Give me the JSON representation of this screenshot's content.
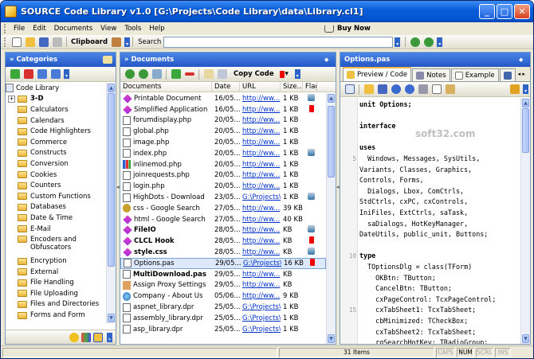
{
  "window": {
    "title": "SOURCE Code Library v1.0 [G:\\Projects\\Code Library\\data\\Library.cl1]"
  },
  "menu": {
    "items": [
      "File",
      "Edit",
      "Documents",
      "View",
      "Tools",
      "Help"
    ],
    "buy_now": "Buy Now"
  },
  "toolbar": {
    "clipboard_label": "Clipboard",
    "search_label": "Search",
    "search_value": ""
  },
  "categories": {
    "title": "» Categories",
    "root": "Code Library",
    "items": [
      "3-D",
      "Calculators",
      "Calendars",
      "Code Highlighters",
      "Commerce",
      "Constructs",
      "Conversion",
      "Cookies",
      "Counters",
      "Custom Functions",
      "Databases",
      "Date & Time",
      "E-Mail",
      "Encoders and Obfuscators",
      "Encryption",
      "External",
      "File Handling",
      "File Uploading",
      "Files and Directories",
      "Forms and Form"
    ]
  },
  "documents": {
    "title": "» Documents",
    "copy_code_label": "Copy Code",
    "columns": [
      "Documents",
      "Date",
      "URL",
      "Size...",
      "Flag"
    ],
    "rows": [
      {
        "name": "Printable Document",
        "date": "16/05...",
        "url": "http://ww...",
        "size": "1 KB",
        "flag": "user",
        "icon": "web",
        "bold": false,
        "selected": false
      },
      {
        "name": "Simplified Application",
        "date": "16/05...",
        "url": "http://ww...",
        "size": "1 KB",
        "flag": "red",
        "icon": "web",
        "bold": false,
        "selected": false
      },
      {
        "name": "forumdisplay.php",
        "date": "20/05...",
        "url": "http://ww...",
        "size": "1 KB",
        "flag": "",
        "icon": "doc",
        "bold": false,
        "selected": false
      },
      {
        "name": "global.php",
        "date": "20/05...",
        "url": "http://ww...",
        "size": "1 KB",
        "flag": "",
        "icon": "doc",
        "bold": false,
        "selected": false
      },
      {
        "name": "image.php",
        "date": "20/05...",
        "url": "http://ww...",
        "size": "1 KB",
        "flag": "",
        "icon": "doc",
        "bold": false,
        "selected": false
      },
      {
        "name": "index.php",
        "date": "20/05...",
        "url": "http://ww...",
        "size": "1 KB",
        "flag": "user",
        "icon": "doc",
        "bold": false,
        "selected": false
      },
      {
        "name": "inlinemod.php",
        "date": "20/05...",
        "url": "http://ww...",
        "size": "1 KB",
        "flag": "",
        "icon": "bars",
        "bold": false,
        "selected": false
      },
      {
        "name": "joinrequests.php",
        "date": "20/05...",
        "url": "http://ww...",
        "size": "1 KB",
        "flag": "",
        "icon": "doc",
        "bold": false,
        "selected": false
      },
      {
        "name": "login.php",
        "date": "20/05...",
        "url": "http://ww...",
        "size": "1 KB",
        "flag": "",
        "icon": "doc",
        "bold": false,
        "selected": false
      },
      {
        "name": "HighDots - Download",
        "date": "23/05...",
        "url": "G:\\Projects\\",
        "size": "1 KB",
        "flag": "user",
        "icon": "doc",
        "bold": false,
        "selected": false
      },
      {
        "name": "css - Google Search",
        "date": "27/05...",
        "url": "http://ww...",
        "size": "39 KB",
        "flag": "",
        "icon": "gear",
        "bold": false,
        "selected": false
      },
      {
        "name": "html - Google Search",
        "date": "27/05...",
        "url": "http://ww...",
        "size": "40 KB",
        "flag": "",
        "icon": "web",
        "bold": false,
        "selected": false
      },
      {
        "name": "FileIO",
        "date": "28/05...",
        "url": "http://ww...",
        "size": "KB",
        "flag": "user",
        "icon": "web",
        "bold": true,
        "selected": false
      },
      {
        "name": "CLCL Hook",
        "date": "28/05...",
        "url": "http://ww...",
        "size": "KB",
        "flag": "red",
        "icon": "web",
        "bold": true,
        "selected": false
      },
      {
        "name": "style.css",
        "date": "28/05...",
        "url": "http://ww...",
        "size": "KB",
        "flag": "user",
        "icon": "web",
        "bold": true,
        "selected": false
      },
      {
        "name": "Options.pas",
        "date": "29/05...",
        "url": "G:\\Projects\\",
        "size": "16 KB",
        "flag": "red",
        "icon": "doc",
        "bold": false,
        "selected": true
      },
      {
        "name": "MultiDownload.pas",
        "date": "29/05...",
        "url": "http://ww...",
        "size": "KB",
        "flag": "",
        "icon": "doc",
        "bold": true,
        "selected": false
      },
      {
        "name": "Assign Proxy Settings",
        "date": "29/05...",
        "url": "http://ww...",
        "size": "KB",
        "flag": "",
        "icon": "hand",
        "bold": false,
        "selected": false
      },
      {
        "name": "Company - About Us",
        "date": "05/06...",
        "url": "http://ww...",
        "size": "9 KB",
        "flag": "",
        "icon": "globe",
        "bold": false,
        "selected": false
      },
      {
        "name": "aspnet_library.dpr",
        "date": "25/05...",
        "url": "G:\\Projects\\",
        "size": "1 KB",
        "flag": "",
        "icon": "doc",
        "bold": false,
        "selected": false
      },
      {
        "name": "assembly_library.dpr",
        "date": "25/05...",
        "url": "G:\\Projects\\",
        "size": "1 KB",
        "flag": "",
        "icon": "doc",
        "bold": false,
        "selected": false
      },
      {
        "name": "asp_library.dpr",
        "date": "25/05...",
        "url": "G:\\Projects\\",
        "size": "1 KB",
        "flag": "",
        "icon": "doc",
        "bold": false,
        "selected": false
      }
    ]
  },
  "editor": {
    "title": "Options.pas",
    "tabs": [
      "Preview / Code",
      "Notes",
      "Example"
    ],
    "watermark": "soft32.com",
    "lines": [
      {
        "n": "",
        "t": "unit Options;",
        "b": "unit"
      },
      {
        "n": "",
        "t": "",
        "b": ""
      },
      {
        "n": "",
        "t": "interface",
        "b": "interface"
      },
      {
        "n": "",
        "t": "",
        "b": ""
      },
      {
        "n": "",
        "t": "uses",
        "b": "uses"
      },
      {
        "n": "5",
        "t": "  Windows, Messages, SysUtils,",
        "b": ""
      },
      {
        "n": "",
        "t": "Variants, Classes, Graphics,",
        "b": ""
      },
      {
        "n": "",
        "t": "Controls, Forms,",
        "b": ""
      },
      {
        "n": "",
        "t": "  Dialogs, Lbox, ComCtrls,",
        "b": ""
      },
      {
        "n": "",
        "t": "StdCtrls, cxPC, cxControls,",
        "b": ""
      },
      {
        "n": "",
        "t": "IniFiles, ExtCtrls, saTask,",
        "b": ""
      },
      {
        "n": "",
        "t": "  saDialogs, HotKeyManager,",
        "b": ""
      },
      {
        "n": "",
        "t": "DateUtils, public_unit, Buttons;",
        "b": ""
      },
      {
        "n": "",
        "t": "",
        "b": ""
      },
      {
        "n": "10",
        "t": "type",
        "b": "type"
      },
      {
        "n": "",
        "t": "  TOptionsDlg = class(TForm)",
        "b": ""
      },
      {
        "n": "",
        "t": "    OKBtn: TButton;",
        "b": ""
      },
      {
        "n": "",
        "t": "    CancelBtn: TButton;",
        "b": ""
      },
      {
        "n": "",
        "t": "    cxPageControl: TcxPageControl;",
        "b": ""
      },
      {
        "n": "15",
        "t": "    cxTabSheet1: TcxTabSheet;",
        "b": ""
      },
      {
        "n": "",
        "t": "    cbMinimized: TCheckBox;",
        "b": ""
      },
      {
        "n": "",
        "t": "    cxTabSheet2: TcxTabSheet;",
        "b": ""
      },
      {
        "n": "",
        "t": "    rgSearchHotKey: TRadioGroup;",
        "b": ""
      },
      {
        "n": "",
        "t": "    HotKey2: THotKey;",
        "b": ""
      },
      {
        "n": "20",
        "t": "    cxTabSheet3: TcxTabSheet;",
        "b": ""
      }
    ]
  },
  "status": {
    "count": "31 Items",
    "caps": "CAPS",
    "num": "NUM",
    "scrl": "SCRL",
    "ins": "INS"
  }
}
